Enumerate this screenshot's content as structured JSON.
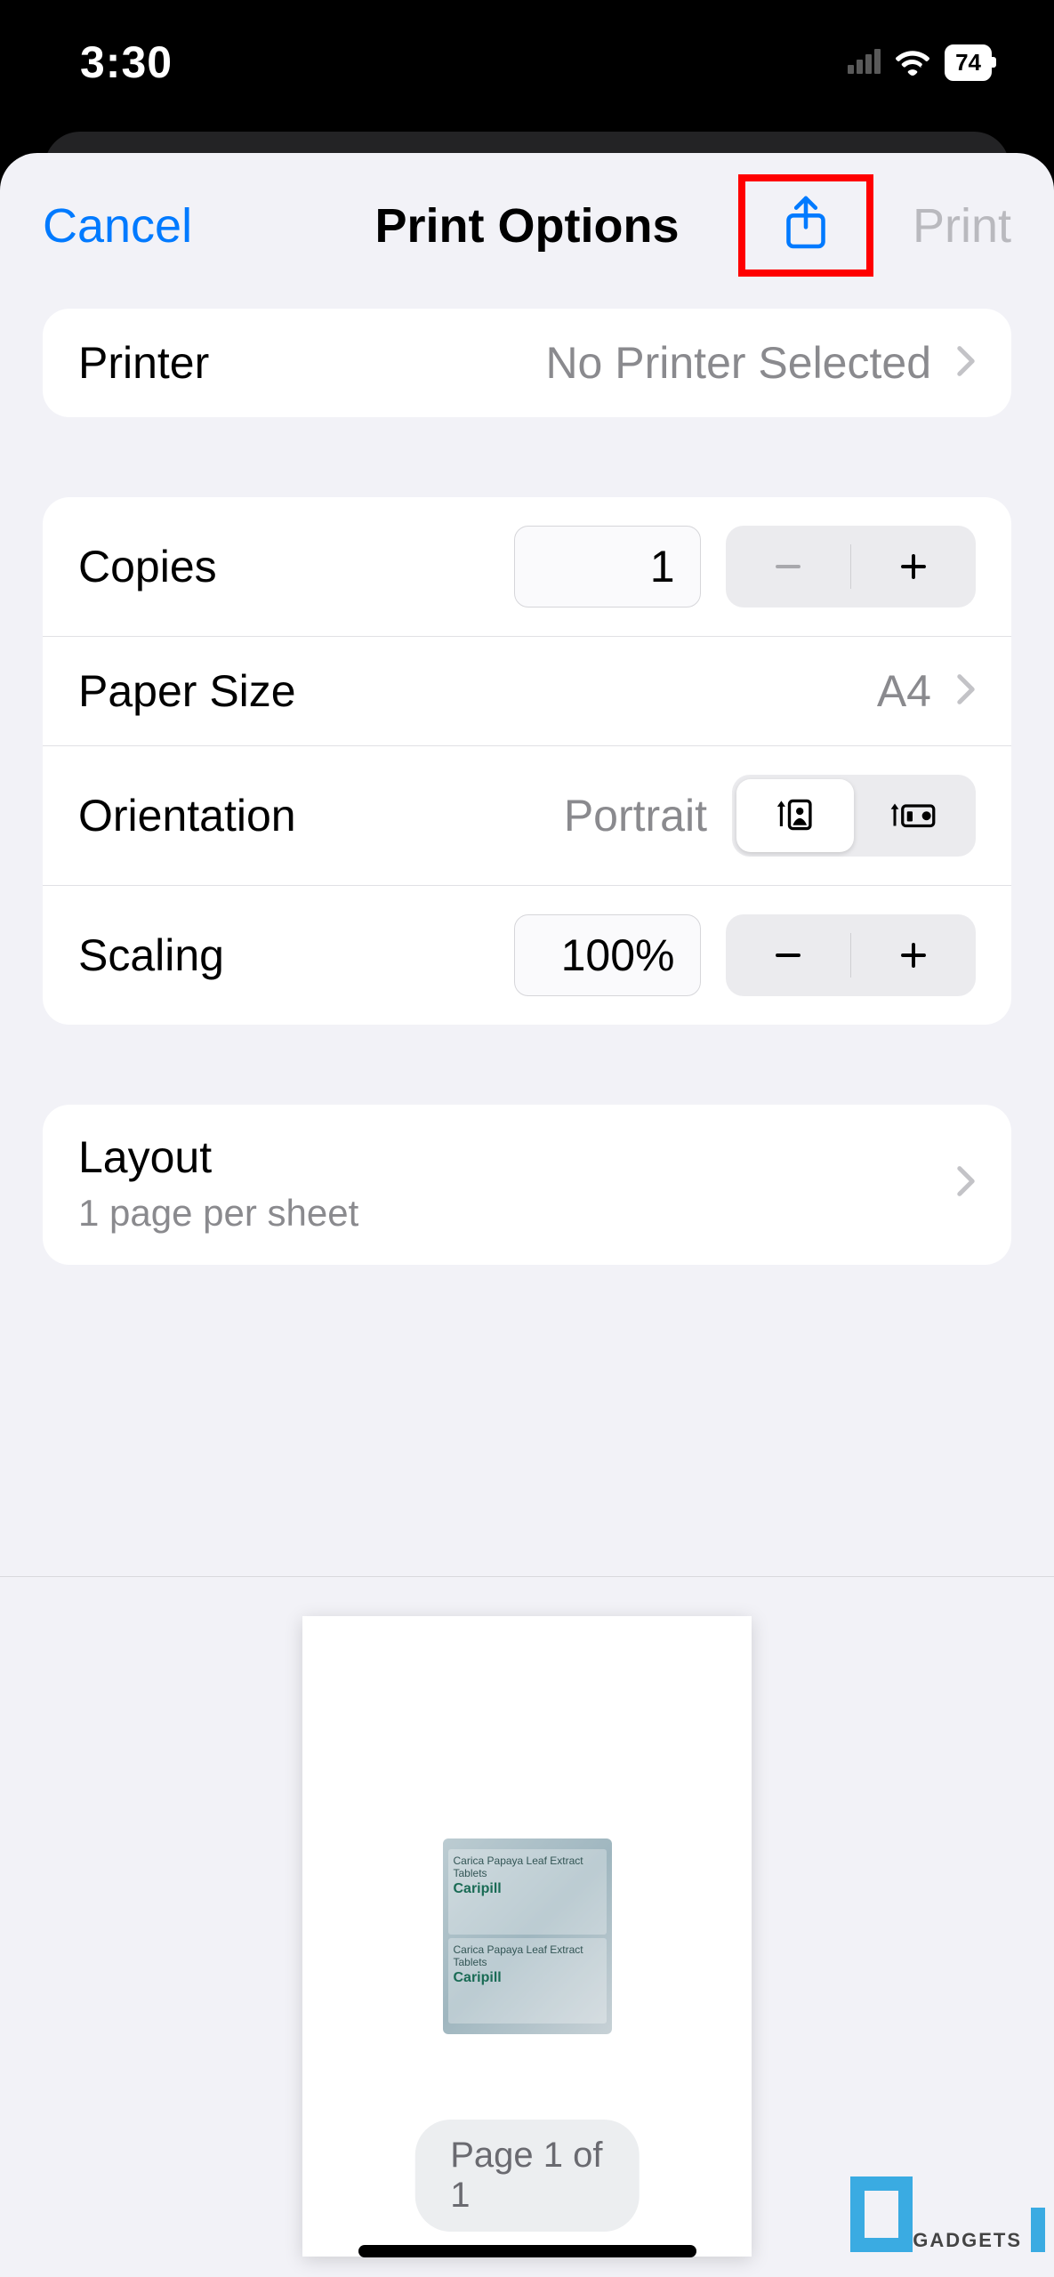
{
  "status": {
    "time": "3:30",
    "battery": "74"
  },
  "nav": {
    "cancel": "Cancel",
    "title": "Print Options",
    "print": "Print"
  },
  "printer": {
    "label": "Printer",
    "value": "No Printer Selected"
  },
  "copies": {
    "label": "Copies",
    "value": "1"
  },
  "paper": {
    "label": "Paper Size",
    "value": "A4"
  },
  "orientation": {
    "label": "Orientation",
    "value": "Portrait"
  },
  "scaling": {
    "label": "Scaling",
    "value": "100%"
  },
  "layout": {
    "label": "Layout",
    "sub": "1 page per sheet"
  },
  "preview": {
    "pageIndicator": "Page 1 of 1",
    "docTitle1": "Carica Papaya Leaf Extract Tablets",
    "docTitle2": "Caripill"
  },
  "watermark": {
    "text": "GADGETS"
  }
}
